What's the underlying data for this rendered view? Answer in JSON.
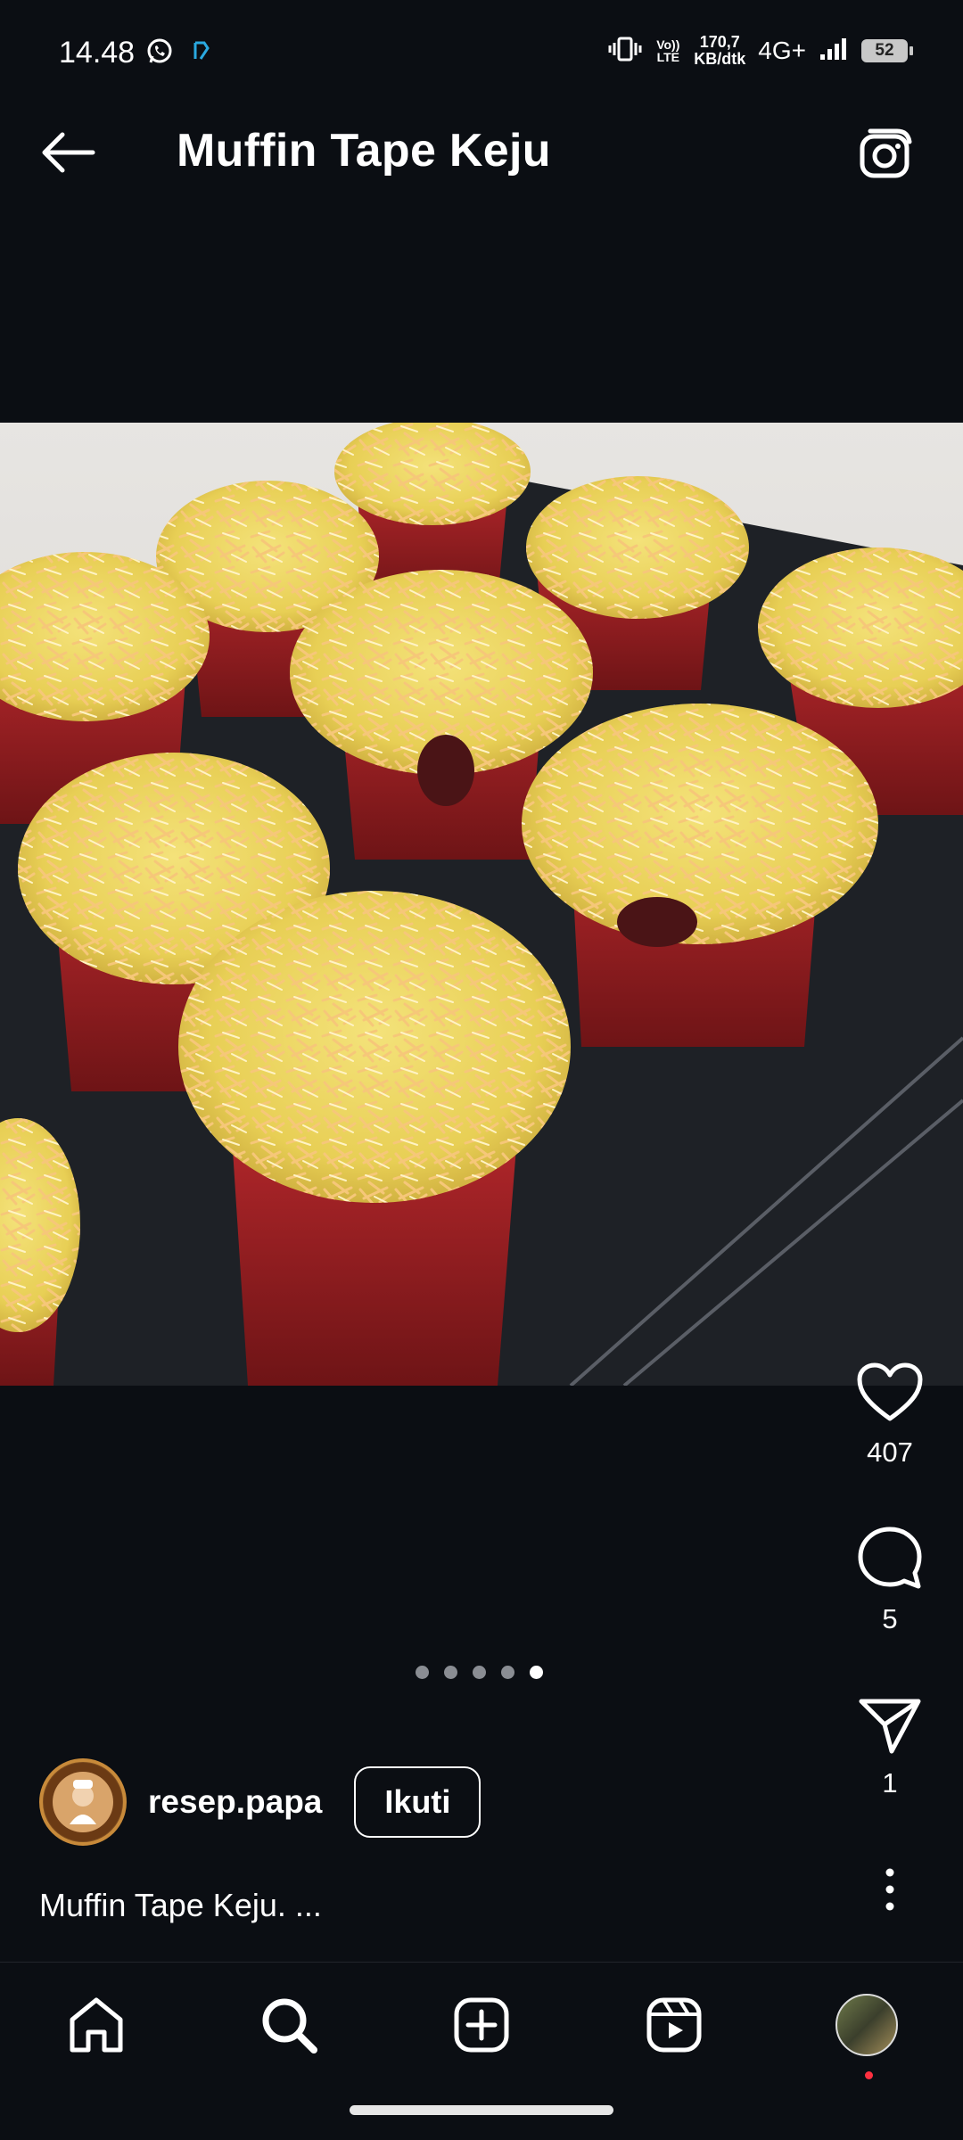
{
  "status_bar": {
    "time": "14.48",
    "net_speed_line1": "170,7",
    "net_speed_line2": "KB/dtk",
    "network_type": "4G+",
    "volte_label": "Vo)) LTE",
    "battery": "52",
    "icons": [
      "whatsapp-icon",
      "app-notification-icon",
      "vibrate-icon",
      "signal-icon"
    ]
  },
  "header": {
    "title": "Muffin Tape Keju",
    "back_icon": "arrow-left-icon",
    "camera_icon": "camera-icon"
  },
  "post": {
    "image_alt": "Muffin tape keju dengan taburan keju parut",
    "carousel": {
      "total": 5,
      "active_index": 4
    }
  },
  "actions": {
    "likes": "407",
    "comments": "5",
    "shares": "1"
  },
  "author": {
    "username": "resep.papa",
    "follow_label": "Ikuti"
  },
  "caption": "Muffin Tape Keju. ...",
  "nav": {
    "items": [
      "home-icon",
      "search-icon",
      "create-icon",
      "reels-icon",
      "profile-avatar"
    ]
  },
  "colors": {
    "background": "#0b0e13",
    "text": "#ffffff",
    "dot_inactive": "#8a8d93",
    "notification_dot": "#ff3040"
  }
}
